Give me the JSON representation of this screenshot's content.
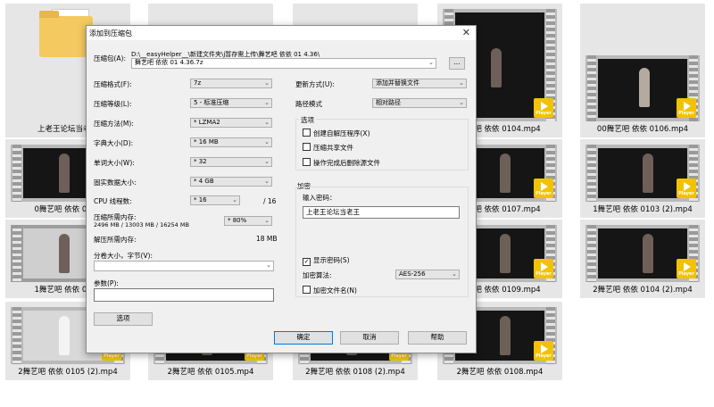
{
  "explorer": {
    "folder_caption": "上老王论坛当老王",
    "tiles": {
      "t_0104": "舞艺吧 依依 0104.mp4",
      "t_0106": "00舞艺吧 依依 0106.mp4",
      "t_0101": "0舞艺吧 依依 0101",
      "t_0107": "舞艺吧 依依 0107.mp4",
      "t_0103_2": "1舞艺吧 依依 0103 (2).mp4",
      "t_0106_2": "1舞艺吧 依依 0106",
      "t_0109": "舞艺吧 依依 0109.mp4",
      "t_0104_2": "2舞艺吧 依依 0104 (2).mp4",
      "t_0105_2": "2舞艺吧 依依 0105 (2).mp4",
      "t_0105": "2舞艺吧 依依 0105.mp4",
      "t_0108_2": "2舞艺吧 依依 0108 (2).mp4",
      "t_0108": "2舞艺吧 依依 0108.mp4"
    },
    "badge_text": "Player"
  },
  "dialog": {
    "title": "添加到压缩包",
    "close_glyph": "✕",
    "archive": {
      "label": "压缩包(A):",
      "path": "D:\\__easyHelper__\\新建文件夹\\j暂存需上传\\舞艺吧 依依 01 4.36\\",
      "name": "舞艺吧 依依 01 4.36.7z",
      "browse_label": "..."
    },
    "left": {
      "format": {
        "label": "压缩格式(F):",
        "value": "7z"
      },
      "level": {
        "label": "压缩等级(L):",
        "value": "5 - 标准压缩"
      },
      "method": {
        "label": "压缩方法(M):",
        "value": "* LZMA2"
      },
      "dict": {
        "label": "字典大小(D):",
        "value": "* 16 MB"
      },
      "word": {
        "label": "单词大小(W):",
        "value": "* 32"
      },
      "solid": {
        "label": "固实数据大小:",
        "value": "* 4 GB"
      },
      "cpu": {
        "label": "CPU 线程数:",
        "value": "* 16",
        "total": "/ 16"
      },
      "mem": {
        "label": "压缩所需内存:",
        "detail": "2496 MB / 13003 MB / 16254 MB",
        "value": "* 80%"
      },
      "decomp": {
        "label": "解压所需内存:",
        "value": "18 MB"
      },
      "volume": {
        "label": "分卷大小，字节(V):",
        "value": ""
      },
      "params": {
        "label": "参数(P):",
        "value": ""
      },
      "options_button": "选项"
    },
    "right": {
      "update": {
        "label": "更新方式(U):",
        "value": "添加并替换文件"
      },
      "pathmode": {
        "label": "路径模式",
        "value": "相对路径"
      },
      "options": {
        "title": "选项",
        "sfx": "创建自解压程序(X)",
        "shared": "压缩共享文件",
        "delete": "操作完成后删除源文件"
      },
      "encrypt": {
        "title": "加密",
        "pwd_label": "输入密码：",
        "password": "上老王论坛当老王",
        "show_pwd": "显示密码(S)",
        "method_label": "加密算法:",
        "method_value": "AES-256",
        "encrypt_names": "加密文件名(N)"
      }
    },
    "buttons": {
      "ok": "确定",
      "cancel": "取消",
      "help": "帮助"
    },
    "check_glyph": "✓",
    "arrow_glyph": "⌄"
  }
}
